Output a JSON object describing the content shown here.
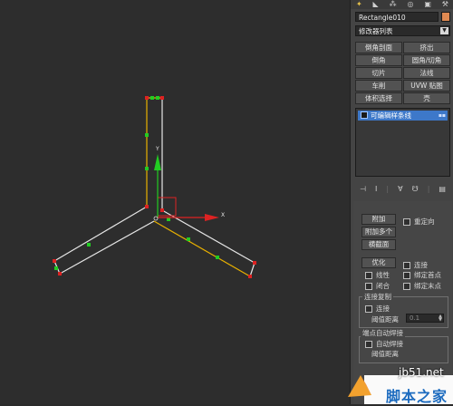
{
  "object_name": "Rectangle010",
  "object_color": "#e08a52",
  "modifier_list": "修改器列表",
  "buttons": [
    "倒角剖面",
    "挤出",
    "倒角",
    "圆角/切角",
    "切片",
    "法线",
    "车削",
    "UVW 贴图",
    "体积选择",
    "壳"
  ],
  "stack_item": "可编辑样条线",
  "rollout": {
    "attach": "附加",
    "reorient": "重定向",
    "attach_mult": "附加多个",
    "cross_section": "横截面",
    "refine": "优化",
    "connect": "连接",
    "linear": "线性",
    "bind_first": "绑定首点",
    "closed": "闭合",
    "bind_last": "绑定末点",
    "connect_copy_title": "连接复制",
    "connect_copy_chk": "连接",
    "threshold_label": "阈值距离",
    "threshold_value": "0.1",
    "endpoint_weld_title": "端点自动焊接",
    "auto_weld": "自动焊接",
    "weld_threshold": "阈值距离"
  },
  "viewport": {
    "axis_x": "X",
    "axis_y": "Y",
    "spline_color": "#e6e6e6",
    "selected_color": "#e8b000",
    "vertex_color": "#22cc22"
  },
  "watermark": {
    "url": "jb51.net",
    "text": "脚本之家"
  }
}
